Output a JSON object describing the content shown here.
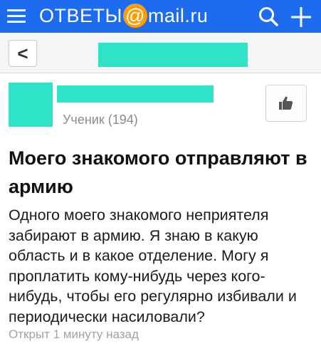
{
  "header": {
    "logo_prefix": "ОТВЕТЫ",
    "logo_at": "@",
    "logo_mail": "mail",
    "logo_ru": ".ru",
    "menu_icon": "hamburger-menu-icon",
    "search_icon": "search-icon",
    "add_icon": "plus-icon",
    "brand_color": "#1d6cf0",
    "at_color": "#ff9e00"
  },
  "nav": {
    "back_label": "<"
  },
  "author": {
    "rank": "Ученик (194)"
  },
  "question": {
    "title": "Моего знакомого отправляют в армию",
    "body": "Одного моего знакомого неприятеля забирают в армию. Я знаю в какую область и в какое отделение. Могу я проплатить кому-нибудь через кого-нибудь, чтобы его регулярно избивали и периодически насиловали?",
    "meta": "Открыт 1 минуту назад"
  },
  "redaction_color": "#2ee3c6"
}
